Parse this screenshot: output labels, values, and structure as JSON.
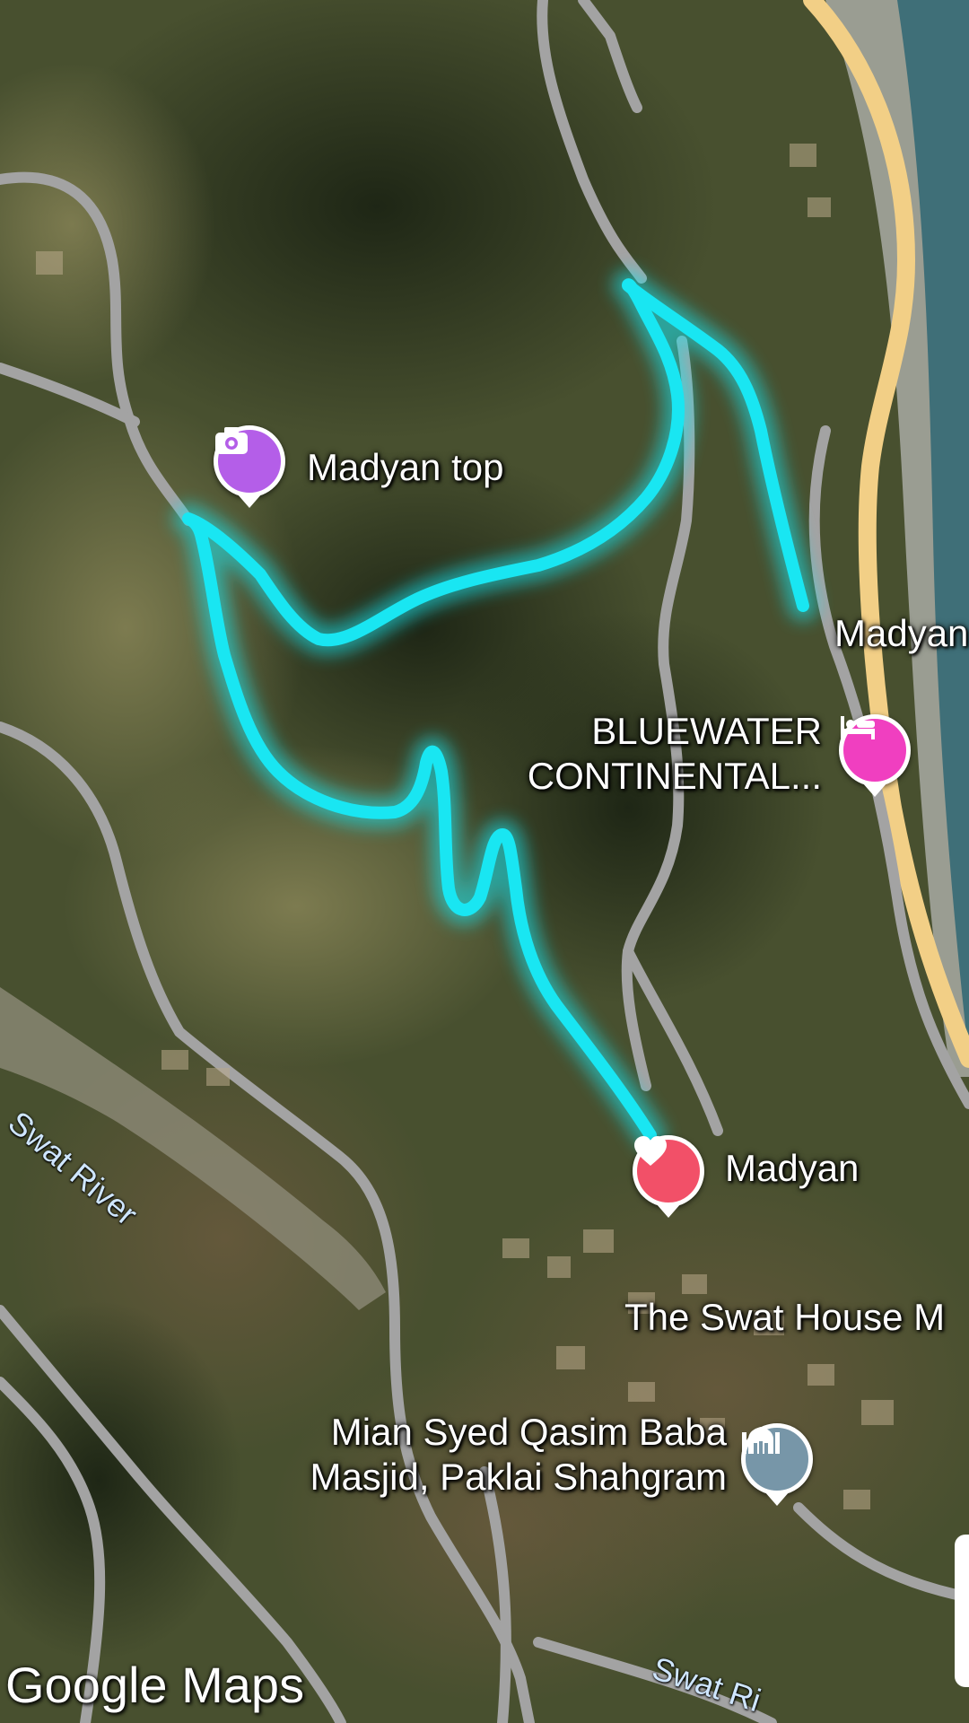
{
  "map": {
    "type": "satellite",
    "watermark": "Google Maps",
    "route_color": "#19e6f2",
    "main_road_color": "#f2cf86",
    "road_color": "#a3a3a3"
  },
  "places": [
    {
      "id": "madyan-top",
      "name": "Madyan top",
      "icon": "camera-icon",
      "color": "#b45ee8"
    },
    {
      "id": "madyan-river",
      "name": "Madyan",
      "icon": "",
      "color": ""
    },
    {
      "id": "bluewater",
      "name": "BLUEWATER CONTINENTAL...",
      "icon": "hotel-bed-icon",
      "color": "#f03fc0"
    },
    {
      "id": "madyan",
      "name": "Madyan",
      "icon": "heart-icon",
      "color": "#f25068"
    },
    {
      "id": "swat-house",
      "name": "The Swat House M",
      "icon": "",
      "color": ""
    },
    {
      "id": "masjid",
      "name": "Mian Syed Qasim Baba Masjid, Paklai Shahgram",
      "icon": "mosque-icon",
      "color": "#7796a8"
    }
  ],
  "rivers": [
    {
      "name": "Swat River"
    },
    {
      "name": "Swat Ri"
    }
  ]
}
